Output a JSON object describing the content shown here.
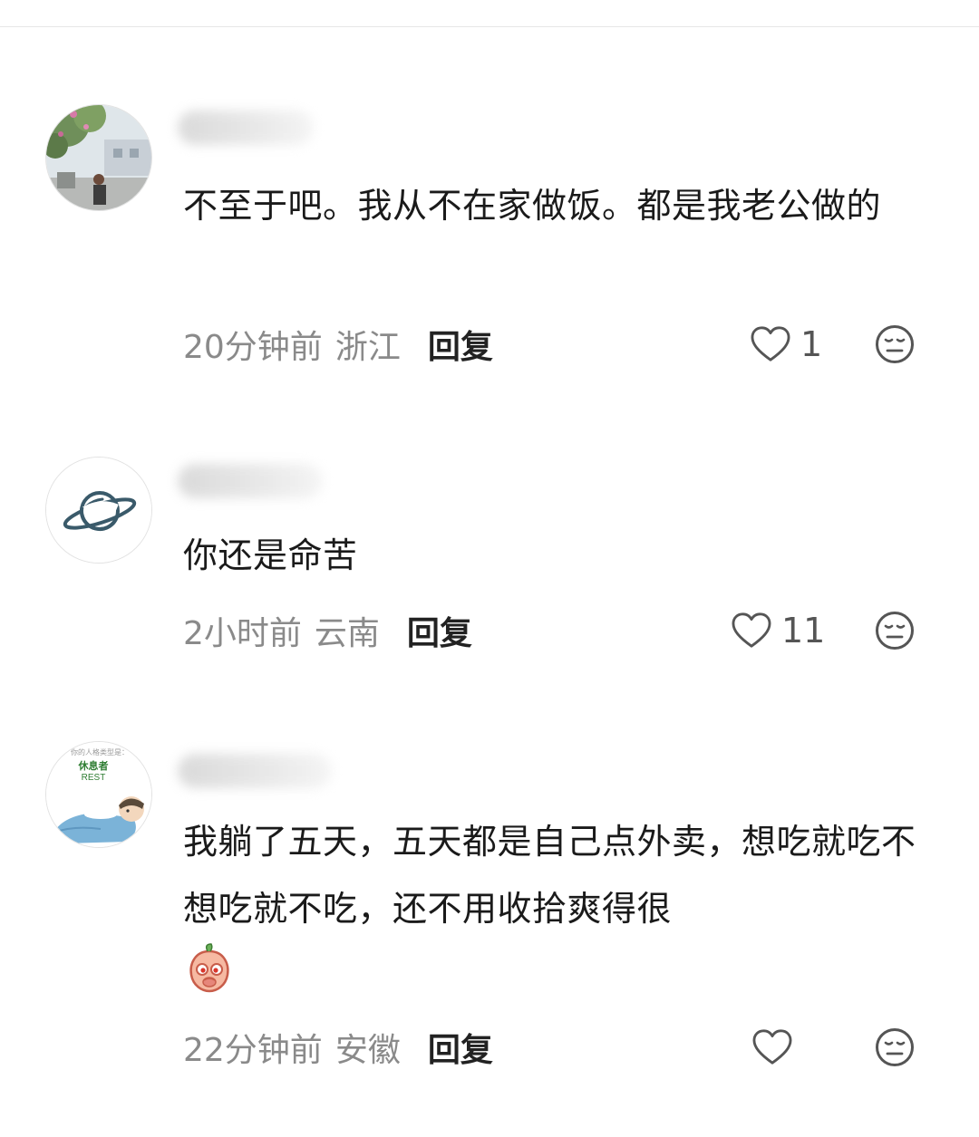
{
  "comments": [
    {
      "text": "不至于吧。我从不在家做饭。都是我老公做的",
      "time": "20分钟前",
      "location": "浙江",
      "reply_label": "回复",
      "like_count": "1"
    },
    {
      "text": "你还是命苦",
      "time": "2小时前",
      "location": "云南",
      "reply_label": "回复",
      "like_count": "11"
    },
    {
      "text": "我躺了五天，五天都是自己点外卖，想吃就吃不想吃就不吃，还不用收拾爽得很",
      "time": "22分钟前",
      "location": "安徽",
      "reply_label": "回复",
      "like_count": ""
    }
  ],
  "avatar3": {
    "line1": "你的人格类型是：",
    "line2": "休息者",
    "line3": "REST"
  },
  "icons": {
    "like": "heart-outline-icon",
    "reaction": "neutral-face-icon",
    "sticker": "peach-emoji-icon"
  },
  "colors": {
    "text": "#1a1a1a",
    "meta": "#8a8a8a",
    "planet": "#3a5a6a",
    "rest_green": "#2e7d32"
  }
}
